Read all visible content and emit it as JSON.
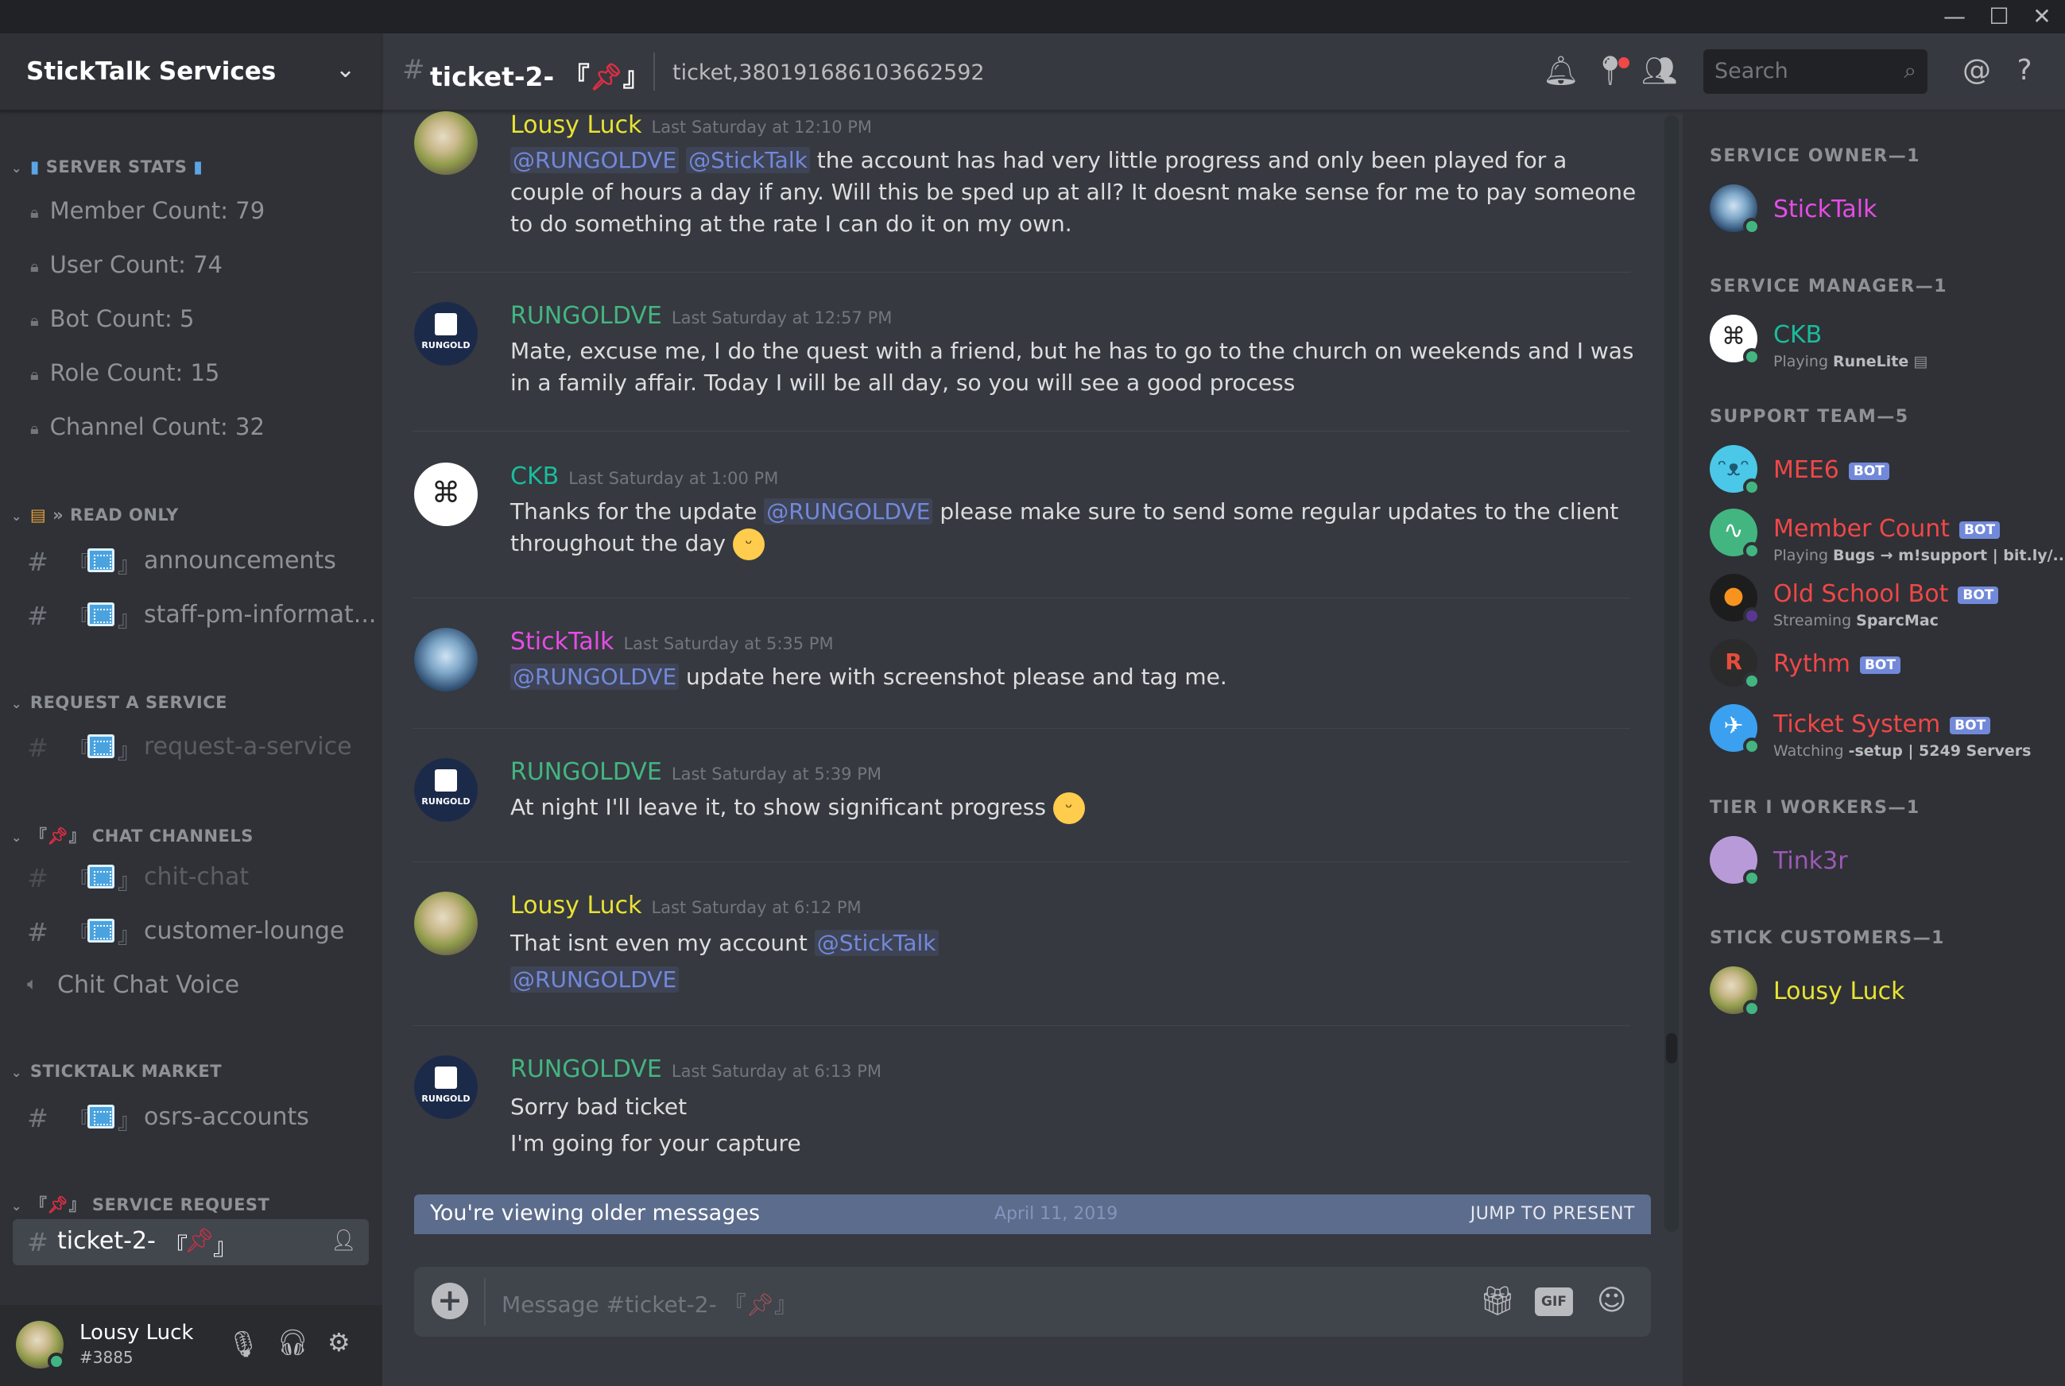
{
  "window": {
    "minimize": "—",
    "maximize": "☐",
    "close": "✕"
  },
  "server": {
    "name": "StickTalk Services"
  },
  "sidebar": {
    "categories": {
      "stats": "SERVER STATS",
      "readonly": "READ ONLY",
      "request": "REQUEST A SERVICE",
      "chat": "CHAT CHANNELS",
      "market": "STICKTALK MARKET",
      "service": "SERVICE REQUEST"
    },
    "stats": [
      "Member Count: 79",
      "User Count: 74",
      "Bot Count: 5",
      "Role Count: 15",
      "Channel Count: 32"
    ],
    "channels": {
      "announcements": "announcements",
      "staff": "staff-pm-informat...",
      "request": "request-a-service",
      "chitchat": "chit-chat",
      "lounge": "customer-lounge",
      "voice": "Chit Chat Voice",
      "osrs": "osrs-accounts",
      "ticket": "ticket-2-"
    }
  },
  "user": {
    "name": "Lousy Luck",
    "tag": "#3885"
  },
  "header": {
    "channel": "ticket-2-",
    "topic": "ticket,380191686103662592",
    "search_placeholder": "Search"
  },
  "messages": [
    {
      "author": "Lousy Luck",
      "ts": "Last Saturday at 12:10 PM",
      "m1": "@RUNGOLDVE",
      "m2": "@StickTalk",
      "text": " the account has had very little progress and only been played for a couple of hours a day if any. Will this be sped up at all? It doesnt make sense for me to pay someone to do something at the rate I can do it on my own."
    },
    {
      "author": "RUNGOLDVE",
      "ts": "Last Saturday at 12:57 PM",
      "text": "Mate, excuse me, I do the quest with a friend, but he has to go to the church on weekends and I was in a family affair. Today I will be all day, so you will see a good process"
    },
    {
      "author": "CKB",
      "ts": "Last Saturday at 1:00 PM",
      "pre": "Thanks for the update ",
      "m1": "@RUNGOLDVE",
      "post": " please make sure to send some regular updates to the client throughout the day"
    },
    {
      "author": "StickTalk",
      "ts": "Last Saturday at 5:35 PM",
      "m1": "@RUNGOLDVE",
      "text": " update here with screenshot please and tag me."
    },
    {
      "author": "RUNGOLDVE",
      "ts": "Last Saturday at 5:39 PM",
      "text": "At night I'll leave it, to show significant progress"
    },
    {
      "author": "Lousy Luck",
      "ts": "Last Saturday at 6:12 PM",
      "text": "That isnt even my account ",
      "m1": "@StickTalk",
      "m2": "@RUNGOLDVE"
    },
    {
      "author": "RUNGOLDVE",
      "ts": "Last Saturday at 6:13 PM",
      "l1": "Sorry bad ticket",
      "l2": "I'm going for your capture"
    }
  ],
  "avatar_label": "RUNGOLD",
  "banner": {
    "text": "You're viewing older messages",
    "jump": "JUMP TO PRESENT",
    "date": "April 11, 2019"
  },
  "composer": {
    "placeholder": "Message #ticket-2-",
    "gif": "GIF"
  },
  "members": {
    "cats": {
      "owner": "SERVICE OWNER—1",
      "manager": "SERVICE MANAGER—1",
      "support": "SUPPORT TEAM—5",
      "tier": "TIER I WORKERS—1",
      "customers": "STICK CUSTOMERS—1"
    },
    "sticktalk": {
      "name": "StickTalk"
    },
    "ckb": {
      "name": "CKB",
      "playing": "Playing ",
      "game": "RuneLite"
    },
    "mee6": {
      "name": "MEE6"
    },
    "membercount": {
      "name": "Member Count",
      "playing": "Playing ",
      "game": "Bugs → m!support | bit.ly/..."
    },
    "osb": {
      "name": "Old School Bot",
      "playing": "Streaming ",
      "game": "SparcMac"
    },
    "rythm": {
      "name": "Rythm"
    },
    "ticket": {
      "name": "Ticket System",
      "playing": "Watching ",
      "game": "-setup | 5249 Servers"
    },
    "tink": {
      "name": "Tink3r"
    },
    "lousy": {
      "name": "Lousy Luck"
    },
    "bot_label": "BOT"
  },
  "colors": {
    "lousy": "#e9e332",
    "rungold": "#43b581",
    "ckb": "#1abc9c",
    "sticktalk": "#e64ce6",
    "red": "#f04747",
    "purple": "#9b59b6",
    "accent": "#7289da"
  }
}
